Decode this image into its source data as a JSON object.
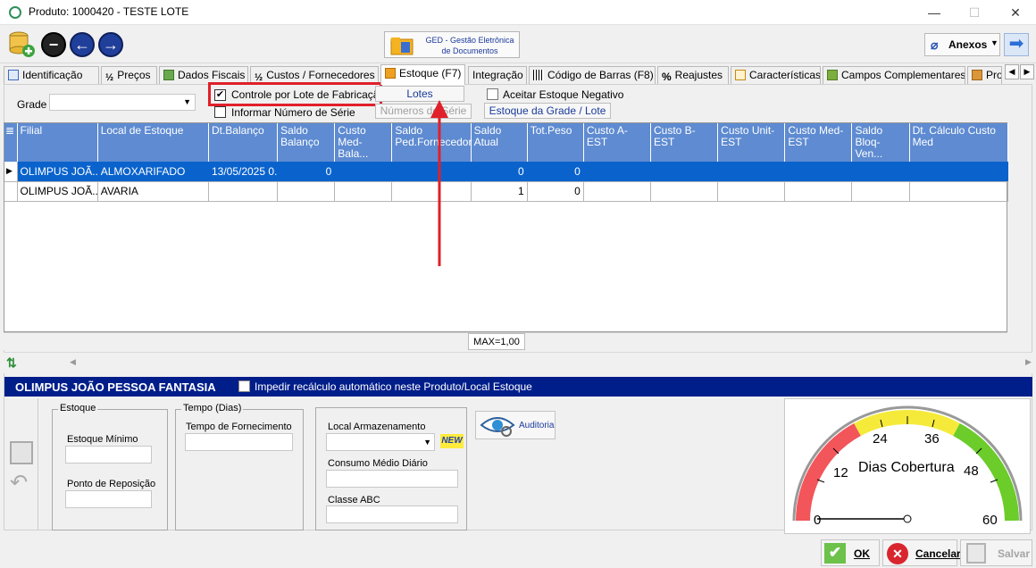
{
  "window": {
    "title": "Produto: 1000420 - TESTE LOTE",
    "minimize": "—",
    "maximize": "☐",
    "close": "✕"
  },
  "toolbar": {
    "ged_label": "GED - Gestão Eletrônica de Documentos",
    "anexos_label": "Anexos"
  },
  "tabs": [
    {
      "label": "Identificação"
    },
    {
      "label": "Preços"
    },
    {
      "label": "Dados Fiscais"
    },
    {
      "label": "Custos / Fornecedores"
    },
    {
      "label": "Estoque (F7)"
    },
    {
      "label": "Integração"
    },
    {
      "label": "Código de Barras (F8)"
    },
    {
      "label": "Reajustes"
    },
    {
      "label": "Características"
    },
    {
      "label": "Campos Complementares"
    },
    {
      "label": "Pro"
    }
  ],
  "controls": {
    "grade_label": "Grade :",
    "controle_lote_label": "Controle por Lote de Fabricação",
    "informar_serie_label": "Informar Número de Série",
    "lotes_button": "Lotes",
    "numeros_serie_button": "Números de Série",
    "aceitar_negativo_label": "Aceitar Estoque Negativo",
    "estoque_grade_button": "Estoque da Grade / Lote"
  },
  "table": {
    "columns": [
      "Filial",
      "Local de Estoque",
      "Dt.Balanço",
      "Saldo Balanço",
      "Custo Med-Bala...",
      "Saldo Ped.Fornecedor",
      "Saldo Atual",
      "Tot.Peso",
      "Custo A-EST",
      "Custo B-EST",
      "Custo Unit-EST",
      "Custo Med-EST",
      "Saldo Bloq-Ven...",
      "Dt. Cálculo Custo Med"
    ],
    "rows": [
      [
        "OLIMPUS JOÃ...",
        "ALMOXARIFADO",
        "13/05/2025 0...",
        "0",
        "",
        "",
        "0",
        "0",
        "",
        "",
        "",
        "",
        "",
        ""
      ],
      [
        "OLIMPUS JOÃ...",
        "AVARIA",
        "",
        "",
        "",
        "",
        "1",
        "0",
        "",
        "",
        "",
        "",
        "",
        ""
      ]
    ],
    "footer": "MAX=1,00"
  },
  "detail": {
    "band_title": "OLIMPUS JOÃO PESSOA FANTASIA",
    "impedir_label": "Impedir recálculo automático neste Produto/Local Estoque",
    "estoque_group": "Estoque",
    "estoque_minimo_label": "Estoque Mínimo",
    "ponto_reposicao_label": "Ponto de Reposição",
    "tempo_group": "Tempo (Dias)",
    "tempo_fornecimento_label": "Tempo de Fornecimento",
    "local_armazenamento_label": "Local Armazenamento",
    "new_badge": "NEW",
    "consumo_label": "Consumo Médio Diário",
    "classe_label": "Classe ABC",
    "auditoria_button": "Auditoria"
  },
  "gauge": {
    "title": "Dias Cobertura",
    "ticks": [
      "0",
      "12",
      "24",
      "36",
      "48",
      "60"
    ],
    "value": 0
  },
  "buttons": {
    "ok": "OK",
    "cancelar": "Cancelar",
    "salvar": "Salvar"
  },
  "colors": {
    "header_blue": "#5e8bd1",
    "selection": "#0a63cc",
    "band": "#001e8a",
    "highlight_red": "#e0202a"
  }
}
